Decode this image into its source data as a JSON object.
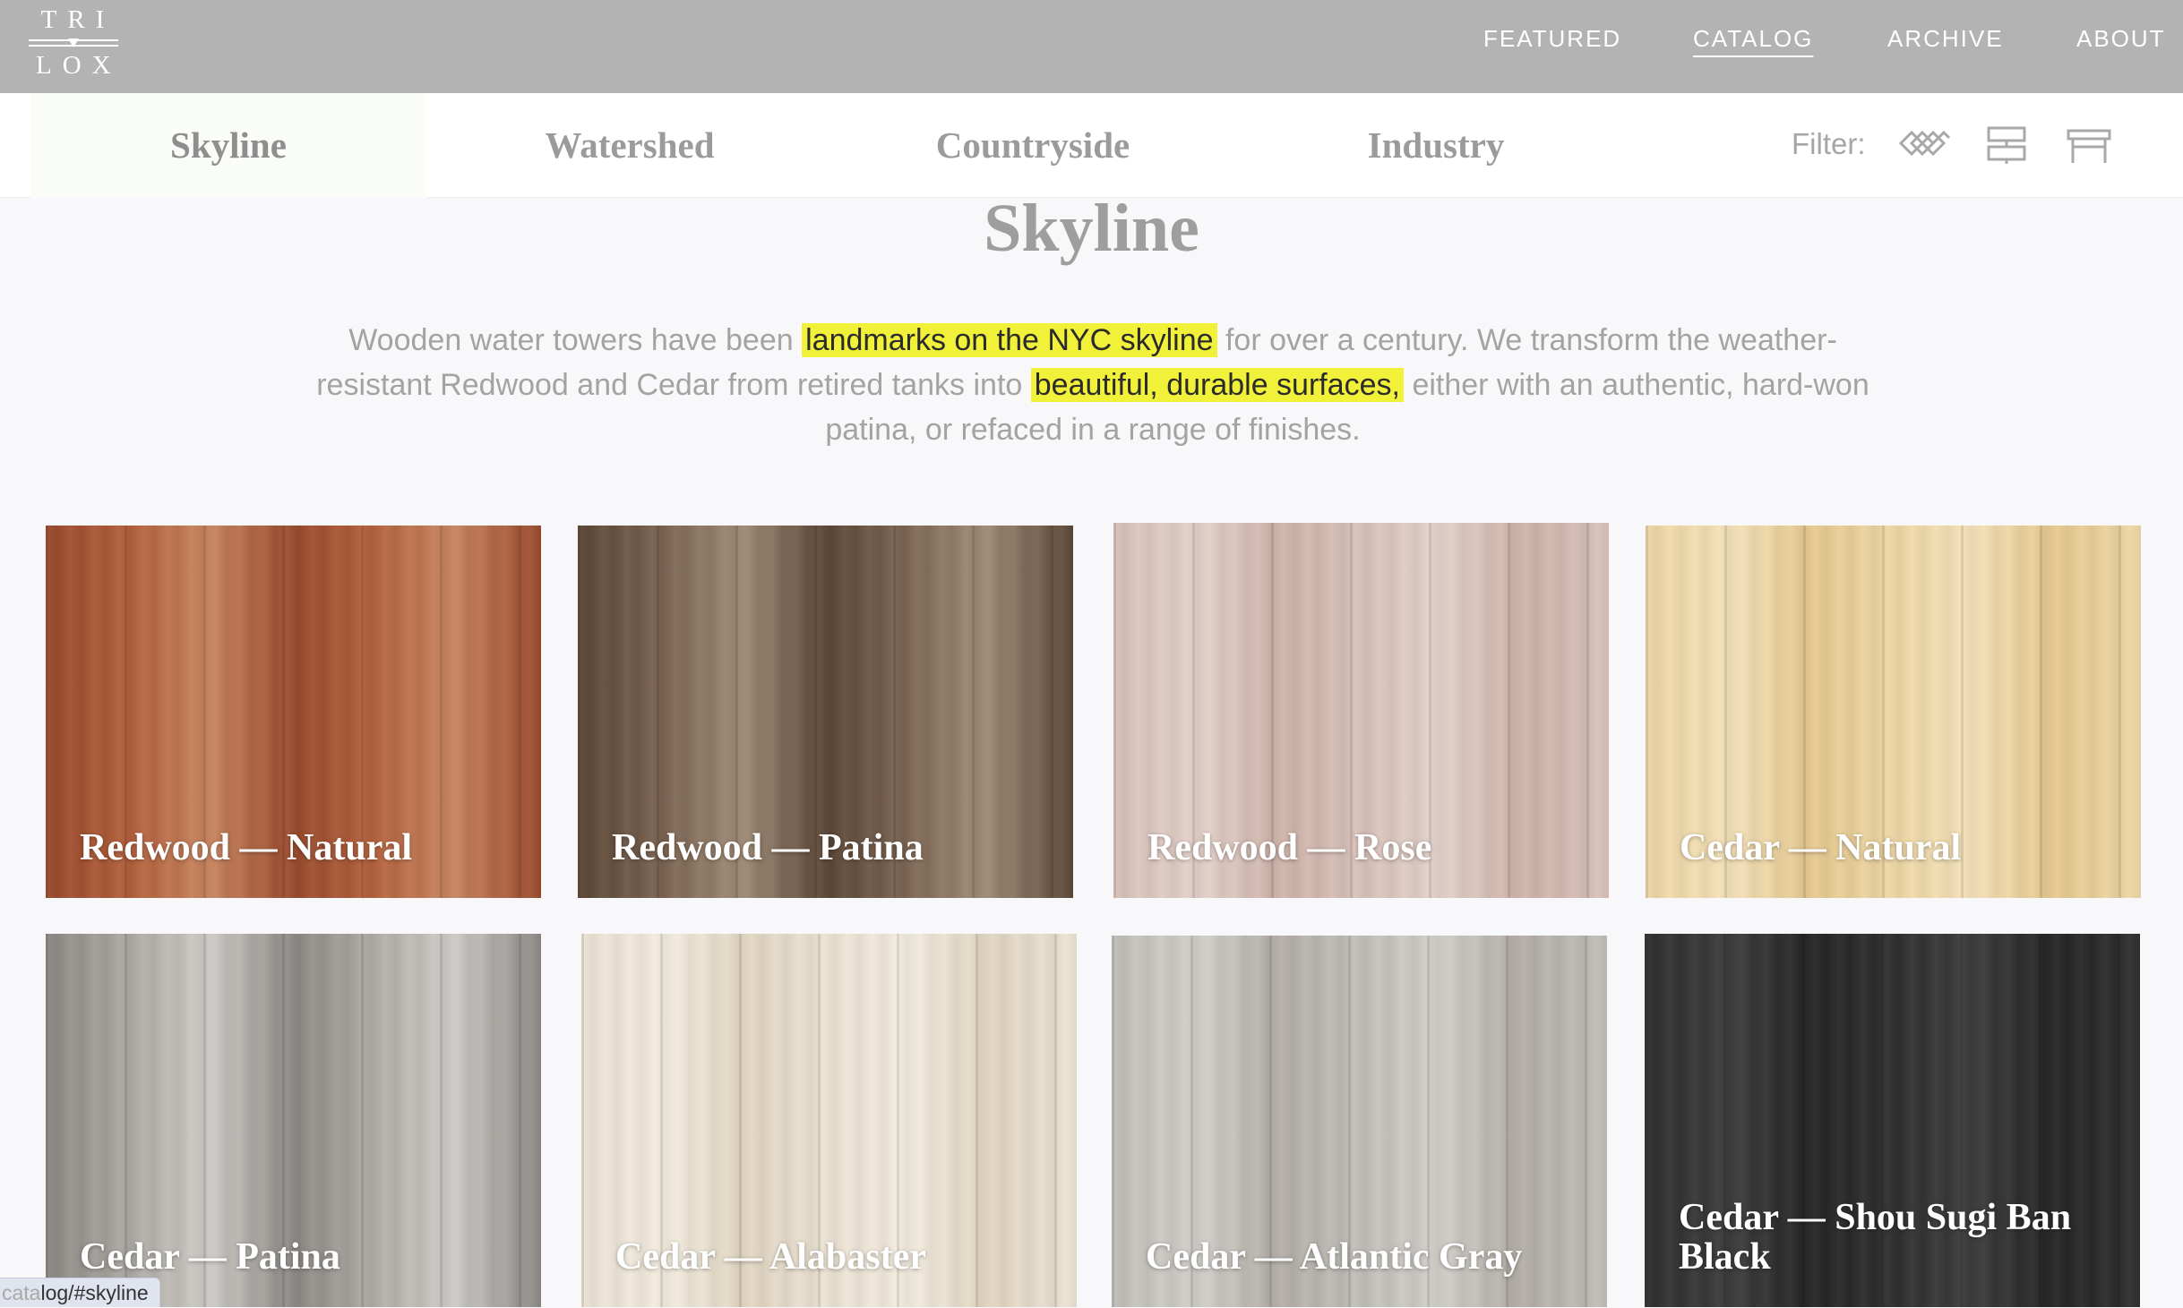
{
  "brand": {
    "line1": "TRI",
    "line2": "LOX"
  },
  "nav": {
    "featured": "FEATURED",
    "catalog": "CATALOG",
    "archive": "ARCHIVE",
    "about": "ABOUT"
  },
  "tabs": [
    "Skyline",
    "Watershed",
    "Countryside",
    "Industry"
  ],
  "filter": {
    "label": "Filter:",
    "icons": [
      "flooring-pattern-icon",
      "wall-panel-icon",
      "table-icon"
    ]
  },
  "section": {
    "title": "Skyline",
    "intro_part1": "Wooden water towers have been ",
    "intro_highlight1": "landmarks on the NYC skyline",
    "intro_part2": " for over a century. We transform the weather-resistant Redwood and Cedar from retired tanks into ",
    "intro_highlight2": "beautiful, durable surfaces,",
    "intro_part3": " either with an authentic, hard-won patina, or refaced in a range of finishes."
  },
  "products": [
    {
      "name": "Redwood — Natural",
      "colors": [
        "#9a4a2c",
        "#b5623d",
        "#c98660"
      ]
    },
    {
      "name": "Redwood — Patina",
      "colors": [
        "#5b4636",
        "#7d6553",
        "#a08c77"
      ]
    },
    {
      "name": "Redwood — Rose",
      "colors": [
        "#d9c2ba",
        "#e4d2cb",
        "#cfb3a9"
      ]
    },
    {
      "name": "Cedar — Natural",
      "colors": [
        "#efd8a6",
        "#f5e2b9",
        "#e6c98f"
      ]
    },
    {
      "name": "Cedar — Patina",
      "colors": [
        "#8c8884",
        "#b0aca7",
        "#d0cdc9"
      ]
    },
    {
      "name": "Cedar — Alabaster",
      "colors": [
        "#ece3d4",
        "#f3ecdf",
        "#e2d6c2"
      ]
    },
    {
      "name": "Cedar — Atlantic Gray",
      "colors": [
        "#c2bfba",
        "#d3d0cb",
        "#b3aea7"
      ]
    },
    {
      "name": "Cedar — Shou Sugi Ban Black",
      "colors": [
        "#2f2f2f",
        "#3d3d3d",
        "#252525"
      ]
    }
  ],
  "status_link": {
    "dim": "cata",
    "rest": "log/#skyline"
  }
}
